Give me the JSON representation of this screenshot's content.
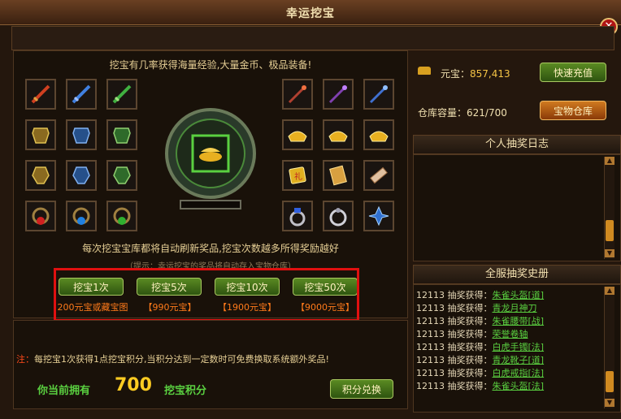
{
  "window": {
    "title": "幸运挖宝"
  },
  "main": {
    "description": "挖宝有几率获得海量经验,大量金币、极品装备!",
    "refresh_hint": "每次挖宝宝库都将自动刷新奖品,挖宝次数越多所得奖励越好",
    "storage_hint": "（提示：幸运挖宝的奖品将自动存入宝物仓库）"
  },
  "dig_buttons": [
    {
      "label": "挖宝1次",
      "cost": "200元宝或藏宝图"
    },
    {
      "label": "挖宝5次",
      "cost": "【990元宝】"
    },
    {
      "label": "挖宝10次",
      "cost": "【1900元宝】"
    },
    {
      "label": "挖宝50次",
      "cost": "【9000元宝】"
    }
  ],
  "note": {
    "prefix": "注：",
    "text": "每挖宝1次获得1点挖宝积分,当积分达到一定数时可免费换取系统额外奖品!"
  },
  "points": {
    "label": "你当前拥有",
    "value": "700",
    "unit": "挖宝积分",
    "exchange_label": "积分兑换"
  },
  "account": {
    "yuanbao_label": "元宝：",
    "yuanbao_value": "857,413",
    "recharge_label": "快速充值",
    "warehouse_label": "仓库容量：",
    "warehouse_value": "621/700",
    "warehouse_button": "宝物仓库"
  },
  "personal_log": {
    "title": "个人抽奖日志"
  },
  "server_history": {
    "title": "全服抽奖史册",
    "rows": [
      {
        "user": "12113",
        "action": "抽奖获得：",
        "item": "朱雀头盔[道]"
      },
      {
        "user": "12113",
        "action": "抽奖获得：",
        "item": "青龙月神刀"
      },
      {
        "user": "12113",
        "action": "抽奖获得：",
        "item": "朱雀腰带[战]"
      },
      {
        "user": "12113",
        "action": "抽奖获得：",
        "item": "荣誉卷轴"
      },
      {
        "user": "12113",
        "action": "抽奖获得：",
        "item": "白虎手镯[法]"
      },
      {
        "user": "12113",
        "action": "抽奖获得：",
        "item": "青龙靴子[道]"
      },
      {
        "user": "12113",
        "action": "抽奖获得：",
        "item": "白虎戒指[法]"
      },
      {
        "user": "12113",
        "action": "抽奖获得：",
        "item": "朱雀头盔[法]"
      }
    ]
  },
  "icons": {
    "left_grid": [
      "red-sword-icon",
      "blue-sword-icon",
      "green-sword-icon",
      "gold-armor-icon",
      "blue-armor-icon",
      "green-armor-icon",
      "gold-armor-icon",
      "blue-armor-icon",
      "green-armor-icon",
      "red-necklace-icon",
      "blue-necklace-icon",
      "green-necklace-icon"
    ],
    "right_grid": [
      "red-staff-icon",
      "purple-staff-icon",
      "blue-staff-icon",
      "gold-ingot-icon",
      "gold-ingot-icon",
      "gold-ingot-icon",
      "gift-package-icon",
      "scroll-icon",
      "map-scroll-icon",
      "blue-ring-icon",
      "silver-ring-icon",
      "blue-ornament-icon"
    ]
  },
  "colors": {
    "accent_gold": "#f5c445",
    "item_green": "#5ad040",
    "cost_orange": "#ff7a1a",
    "highlight_red": "#e01010"
  }
}
